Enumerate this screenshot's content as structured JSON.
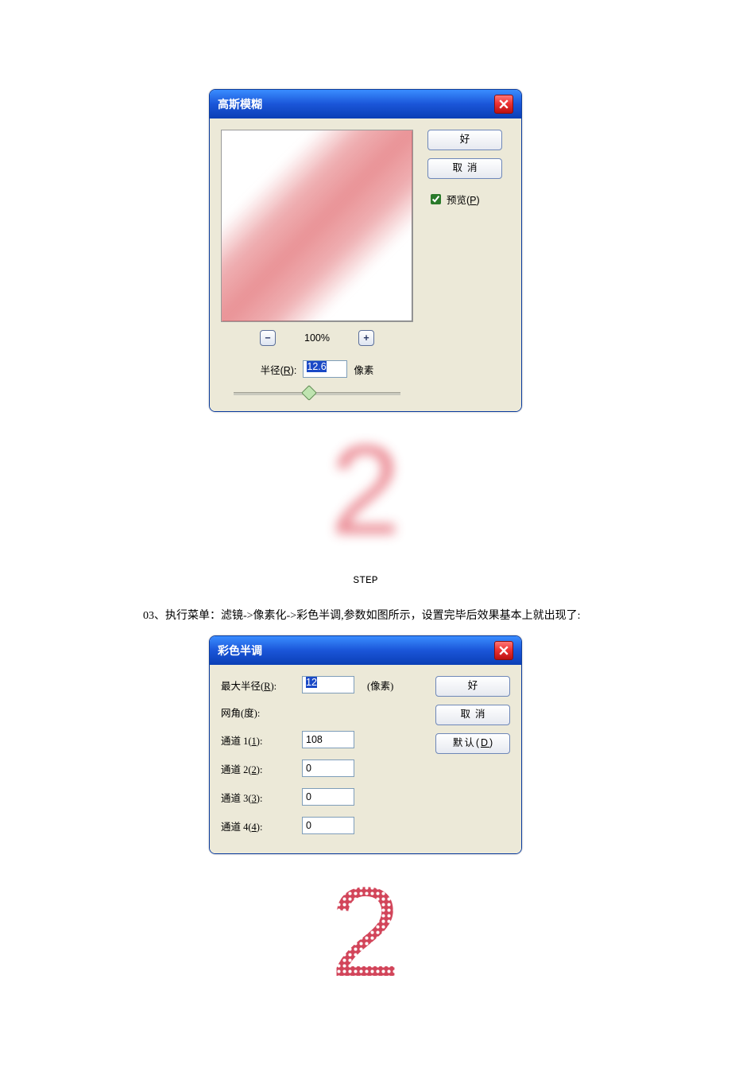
{
  "gaussian": {
    "title": "高斯模糊",
    "ok": "好",
    "cancel": "取消",
    "preview": "预览(",
    "preview_key": "P",
    "preview_suffix": ")",
    "zoom_percent": "100%",
    "radius_label_prefix": "半径(",
    "radius_label_key": "R",
    "radius_label_suffix": "):",
    "radius_value": "12.6",
    "radius_unit": "像素"
  },
  "glyph": {
    "two": "2"
  },
  "caption_step": "STEP",
  "instruction": "03、执行菜单：滤镜->像素化->彩色半调,参数如图所示，设置完毕后效果基本上就出现了:",
  "halftone": {
    "title": "彩色半调",
    "ok": "好",
    "cancel": "取消",
    "defaults_prefix": "默认(",
    "defaults_key": "D",
    "defaults_suffix": ")",
    "max_radius_label_prefix": "最大半径(",
    "max_radius_label_key": "R",
    "max_radius_label_suffix": "):",
    "max_radius_value": "12",
    "max_radius_unit": "(像素)",
    "grid_angle_label": "网角(度):",
    "channel1_label_prefix": "通道 1(",
    "channel1_key": "1",
    "channel1_suffix": "):",
    "channel1_value": "108",
    "channel2_label_prefix": "通道 2(",
    "channel2_key": "2",
    "channel2_suffix": "):",
    "channel2_value": "0",
    "channel3_label_prefix": "通道 3(",
    "channel3_key": "3",
    "channel3_suffix": "):",
    "channel3_value": "0",
    "channel4_label_prefix": "通道 4(",
    "channel4_key": "4",
    "channel4_suffix": "):",
    "channel4_value": "0"
  }
}
